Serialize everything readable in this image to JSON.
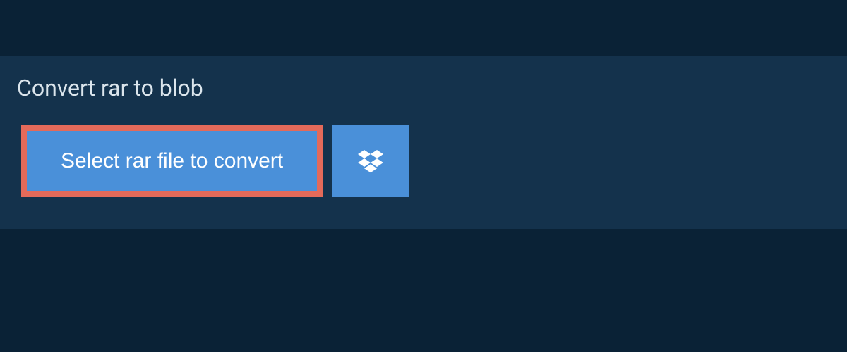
{
  "header": {
    "title": "Convert rar to blob"
  },
  "actions": {
    "select_file_label": "Select rar file to convert"
  },
  "colors": {
    "background": "#0a2236",
    "panel": "#14324c",
    "button": "#4a90d9",
    "highlight_border": "#e46a5a",
    "text_light": "#dbe5ec",
    "text_white": "#ffffff"
  }
}
